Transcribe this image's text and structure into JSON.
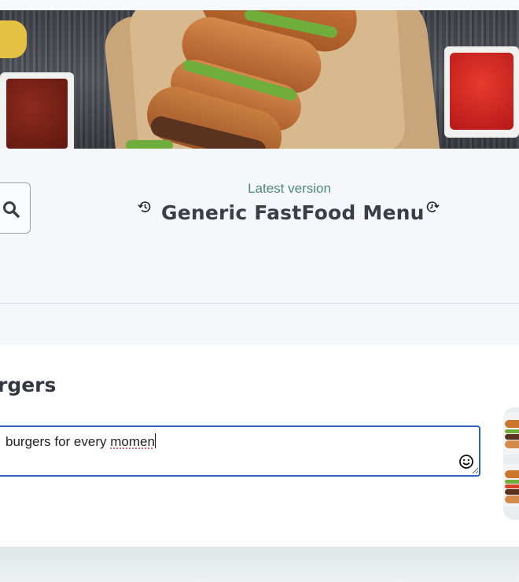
{
  "header": {
    "subtitle": "Latest version",
    "title": "Generic FastFood Menu"
  },
  "section": {
    "title": "rgers"
  },
  "description": {
    "text_before": "burgers for every ",
    "text_misspelled": "momen"
  },
  "icons": {
    "search": "search-icon",
    "history_back": "history-back-icon",
    "history_forward": "history-forward-icon",
    "emoji": "emoji-icon",
    "resize": "resize-grip-icon"
  },
  "colors": {
    "subtitle": "#4b8a73",
    "focus_border": "#2f5fbf",
    "header_bg": "#f5f7fb"
  }
}
